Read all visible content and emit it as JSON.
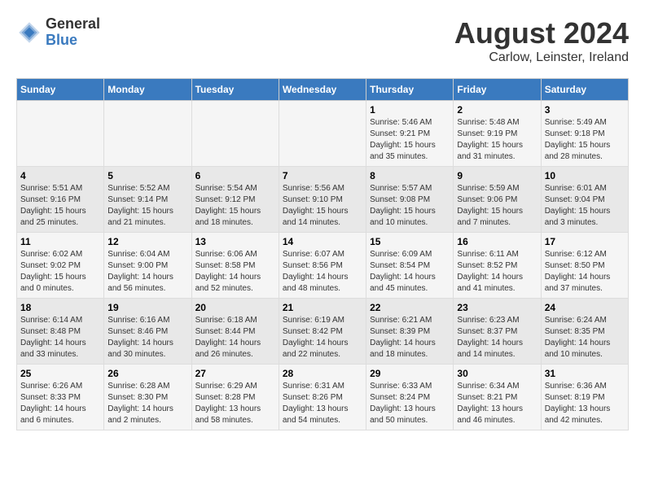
{
  "logo": {
    "general": "General",
    "blue": "Blue"
  },
  "header": {
    "title": "August 2024",
    "subtitle": "Carlow, Leinster, Ireland"
  },
  "weekdays": [
    "Sunday",
    "Monday",
    "Tuesday",
    "Wednesday",
    "Thursday",
    "Friday",
    "Saturday"
  ],
  "weeks": [
    [
      {
        "day": "",
        "info": ""
      },
      {
        "day": "",
        "info": ""
      },
      {
        "day": "",
        "info": ""
      },
      {
        "day": "",
        "info": ""
      },
      {
        "day": "1",
        "info": "Sunrise: 5:46 AM\nSunset: 9:21 PM\nDaylight: 15 hours\nand 35 minutes."
      },
      {
        "day": "2",
        "info": "Sunrise: 5:48 AM\nSunset: 9:19 PM\nDaylight: 15 hours\nand 31 minutes."
      },
      {
        "day": "3",
        "info": "Sunrise: 5:49 AM\nSunset: 9:18 PM\nDaylight: 15 hours\nand 28 minutes."
      }
    ],
    [
      {
        "day": "4",
        "info": "Sunrise: 5:51 AM\nSunset: 9:16 PM\nDaylight: 15 hours\nand 25 minutes."
      },
      {
        "day": "5",
        "info": "Sunrise: 5:52 AM\nSunset: 9:14 PM\nDaylight: 15 hours\nand 21 minutes."
      },
      {
        "day": "6",
        "info": "Sunrise: 5:54 AM\nSunset: 9:12 PM\nDaylight: 15 hours\nand 18 minutes."
      },
      {
        "day": "7",
        "info": "Sunrise: 5:56 AM\nSunset: 9:10 PM\nDaylight: 15 hours\nand 14 minutes."
      },
      {
        "day": "8",
        "info": "Sunrise: 5:57 AM\nSunset: 9:08 PM\nDaylight: 15 hours\nand 10 minutes."
      },
      {
        "day": "9",
        "info": "Sunrise: 5:59 AM\nSunset: 9:06 PM\nDaylight: 15 hours\nand 7 minutes."
      },
      {
        "day": "10",
        "info": "Sunrise: 6:01 AM\nSunset: 9:04 PM\nDaylight: 15 hours\nand 3 minutes."
      }
    ],
    [
      {
        "day": "11",
        "info": "Sunrise: 6:02 AM\nSunset: 9:02 PM\nDaylight: 15 hours\nand 0 minutes."
      },
      {
        "day": "12",
        "info": "Sunrise: 6:04 AM\nSunset: 9:00 PM\nDaylight: 14 hours\nand 56 minutes."
      },
      {
        "day": "13",
        "info": "Sunrise: 6:06 AM\nSunset: 8:58 PM\nDaylight: 14 hours\nand 52 minutes."
      },
      {
        "day": "14",
        "info": "Sunrise: 6:07 AM\nSunset: 8:56 PM\nDaylight: 14 hours\nand 48 minutes."
      },
      {
        "day": "15",
        "info": "Sunrise: 6:09 AM\nSunset: 8:54 PM\nDaylight: 14 hours\nand 45 minutes."
      },
      {
        "day": "16",
        "info": "Sunrise: 6:11 AM\nSunset: 8:52 PM\nDaylight: 14 hours\nand 41 minutes."
      },
      {
        "day": "17",
        "info": "Sunrise: 6:12 AM\nSunset: 8:50 PM\nDaylight: 14 hours\nand 37 minutes."
      }
    ],
    [
      {
        "day": "18",
        "info": "Sunrise: 6:14 AM\nSunset: 8:48 PM\nDaylight: 14 hours\nand 33 minutes."
      },
      {
        "day": "19",
        "info": "Sunrise: 6:16 AM\nSunset: 8:46 PM\nDaylight: 14 hours\nand 30 minutes."
      },
      {
        "day": "20",
        "info": "Sunrise: 6:18 AM\nSunset: 8:44 PM\nDaylight: 14 hours\nand 26 minutes."
      },
      {
        "day": "21",
        "info": "Sunrise: 6:19 AM\nSunset: 8:42 PM\nDaylight: 14 hours\nand 22 minutes."
      },
      {
        "day": "22",
        "info": "Sunrise: 6:21 AM\nSunset: 8:39 PM\nDaylight: 14 hours\nand 18 minutes."
      },
      {
        "day": "23",
        "info": "Sunrise: 6:23 AM\nSunset: 8:37 PM\nDaylight: 14 hours\nand 14 minutes."
      },
      {
        "day": "24",
        "info": "Sunrise: 6:24 AM\nSunset: 8:35 PM\nDaylight: 14 hours\nand 10 minutes."
      }
    ],
    [
      {
        "day": "25",
        "info": "Sunrise: 6:26 AM\nSunset: 8:33 PM\nDaylight: 14 hours\nand 6 minutes."
      },
      {
        "day": "26",
        "info": "Sunrise: 6:28 AM\nSunset: 8:30 PM\nDaylight: 14 hours\nand 2 minutes."
      },
      {
        "day": "27",
        "info": "Sunrise: 6:29 AM\nSunset: 8:28 PM\nDaylight: 13 hours\nand 58 minutes."
      },
      {
        "day": "28",
        "info": "Sunrise: 6:31 AM\nSunset: 8:26 PM\nDaylight: 13 hours\nand 54 minutes."
      },
      {
        "day": "29",
        "info": "Sunrise: 6:33 AM\nSunset: 8:24 PM\nDaylight: 13 hours\nand 50 minutes."
      },
      {
        "day": "30",
        "info": "Sunrise: 6:34 AM\nSunset: 8:21 PM\nDaylight: 13 hours\nand 46 minutes."
      },
      {
        "day": "31",
        "info": "Sunrise: 6:36 AM\nSunset: 8:19 PM\nDaylight: 13 hours\nand 42 minutes."
      }
    ]
  ]
}
